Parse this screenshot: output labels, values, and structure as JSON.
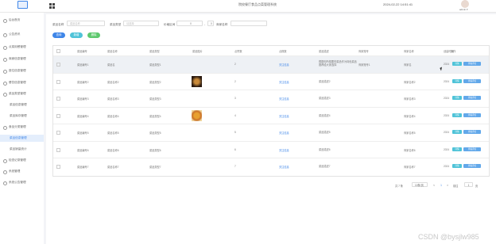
{
  "header": {
    "title": "院校餐厅食品点菜管理系统",
    "datetime": "2024-02-22 14:51:41",
    "user": "admin ▾"
  },
  "sidebar": {
    "items": [
      {
        "label": "后台首页",
        "type": "main"
      },
      {
        "label": "公告资讯",
        "type": "main"
      },
      {
        "label": "点菜用餐管理",
        "type": "main"
      },
      {
        "label": "商家信息管理",
        "type": "main"
      },
      {
        "label": "座位信息管理",
        "type": "main"
      },
      {
        "label": "餐饮信息管理",
        "type": "main"
      },
      {
        "label": "菜品类型管理",
        "type": "main"
      },
      {
        "label": "菜品信息管理",
        "type": "sub"
      },
      {
        "label": "菜品库存管理",
        "type": "sub"
      },
      {
        "label": "食品分类管理",
        "type": "main"
      },
      {
        "label": "菜品信息管理",
        "type": "sub",
        "active": true
      },
      {
        "label": "菜品销量统计",
        "type": "sub"
      },
      {
        "label": "检查记录管理",
        "type": "main"
      },
      {
        "label": "系统管理",
        "type": "main"
      },
      {
        "label": "系统公告管理",
        "type": "main"
      }
    ]
  },
  "filters": {
    "name_label": "菜品名称",
    "name_placeholder": "菜品名称",
    "type_label": "菜品类型",
    "type_placeholder": "请选择",
    "price_label": "价格区间",
    "price_min": "0",
    "price_sep": "-",
    "price_max": "0",
    "seller_label": "商家名称",
    "seller_placeholder": ""
  },
  "actions": {
    "search": "查询",
    "add": "新增",
    "delete": "删除"
  },
  "table": {
    "headers": [
      "菜品编号",
      "菜品名称",
      "菜品类型",
      "菜品图片",
      "点赞数",
      "点踩数",
      "菜品描述",
      "商家账号",
      "商家名称",
      "创建时间",
      "操作"
    ],
    "rows": [
      {
        "no": "菜品编号1",
        "name": "菜品名",
        "type": "菜品类型1",
        "img": "",
        "likes": "2",
        "comment": "关注信息",
        "desc": "根据你所想要的菜品作为特色菜品推荐给大家选择",
        "account": "商家账号1",
        "seller": "商家名",
        "time": "2024"
      },
      {
        "no": "菜品编号2",
        "name": "菜品名称2",
        "type": "菜品类型2",
        "img": "food-dark",
        "likes": "2",
        "comment": "关注信息",
        "desc": "菜品描述2",
        "account": "",
        "seller": "商家名称2",
        "time": "2024"
      },
      {
        "no": "菜品编号3",
        "name": "菜品名称3",
        "type": "菜品类型3",
        "img": "",
        "likes": "3",
        "comment": "关注信息",
        "desc": "菜品描述3",
        "account": "",
        "seller": "商家名称3",
        "time": "2024"
      },
      {
        "no": "菜品编号4",
        "name": "菜品名称4",
        "type": "菜品类型4",
        "img": "food-orange",
        "likes": "4",
        "comment": "关注信息",
        "desc": "菜品描述4",
        "account": "",
        "seller": "商家名称4",
        "time": "2024"
      },
      {
        "no": "菜品编号5",
        "name": "菜品名称5",
        "type": "菜品类型5",
        "img": "",
        "likes": "5",
        "comment": "关注信息",
        "desc": "菜品描述5",
        "account": "",
        "seller": "商家名称5",
        "time": "2024"
      },
      {
        "no": "菜品编号6",
        "name": "菜品名称6",
        "type": "菜品类型6",
        "img": "",
        "likes": "6",
        "comment": "关注信息",
        "desc": "菜品描述6",
        "account": "",
        "seller": "商家名称6",
        "time": "2024"
      },
      {
        "no": "菜品编号7",
        "name": "菜品名称7",
        "type": "菜品类型7",
        "img": "",
        "likes": "7",
        "comment": "关注信息",
        "desc": "菜品描述7",
        "account": "",
        "seller": "商家名称7",
        "time": "2024"
      }
    ],
    "row_actions": {
      "detail": "详情",
      "edit": "查看评论"
    }
  },
  "pager": {
    "total": "共 7 条",
    "size": "10条/页",
    "prev": "<",
    "page": "1",
    "next": ">",
    "goto": "前往",
    "goto_page": "1",
    "goto_suffix": "页"
  },
  "watermark": "CSDN @bysjlw985",
  "colors": {
    "primary": "#3f86e8",
    "success": "#5ec96e",
    "teal": "#4fc3d8",
    "edit": "#62a8ea"
  }
}
